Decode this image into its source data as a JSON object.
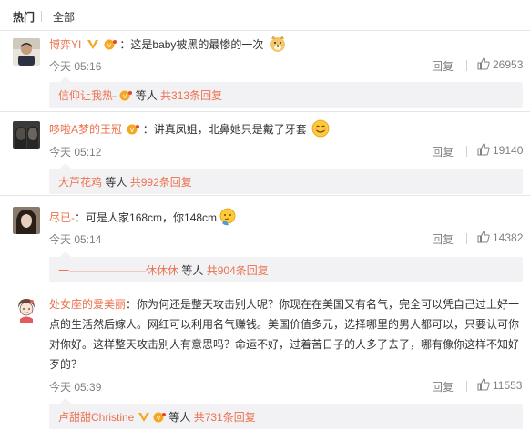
{
  "tabs": {
    "hot": "热门",
    "all": "全部"
  },
  "actions": {
    "reply": "回复"
  },
  "colors": {
    "link": "#eb7350",
    "muted": "#808080",
    "sub_bg": "#f2f2f5"
  },
  "comments": [
    {
      "user": "博弈YI",
      "sep": "：",
      "text": "这是baby被黑的最惨的一次",
      "emoji": "doge-emoji",
      "time": "今天 05:16",
      "likes": "26953",
      "sub": {
        "user": "信仰让我热-",
        "mid": "等人",
        "count": "共313条回复"
      }
    },
    {
      "user": "哆啦A梦的王冠",
      "sep": "：",
      "text": "讲真凤姐，北鼻她只是戴了牙套",
      "emoji": "smile-emoji",
      "time": "今天 05:12",
      "likes": "19140",
      "sub": {
        "user": "大芦花鸡",
        "mid": "等人",
        "count": "共992条回复"
      }
    },
    {
      "user": "尽已-",
      "sep": "：",
      "text": "可是人家168cm，你148cm",
      "emoji": "thinking-emoji",
      "time": "今天 05:14",
      "likes": "14382",
      "sub": {
        "user": "一———————休休休",
        "mid": "等人",
        "count": "共904条回复"
      }
    },
    {
      "user": "处女座的爱美丽",
      "sep": "：",
      "lines": [
        "你为何还是整天攻击别人呢？你现在在美国又有名气，完全可以凭自己过上好一",
        "点的生活然后嫁人。网红可以利用名气赚钱。美国价值多元，选择哪里的男人都可以，只要认可你",
        "对你好。这样整天攻击别人有意思吗？命运不好，过着苦日子的人多了去了，哪有像你这样不知好",
        "歹的？"
      ],
      "time": "今天 05:39",
      "likes": "11553",
      "sub": {
        "user": "卢甜甜Christine",
        "mid": "等人",
        "count": "共731条回复"
      }
    }
  ]
}
